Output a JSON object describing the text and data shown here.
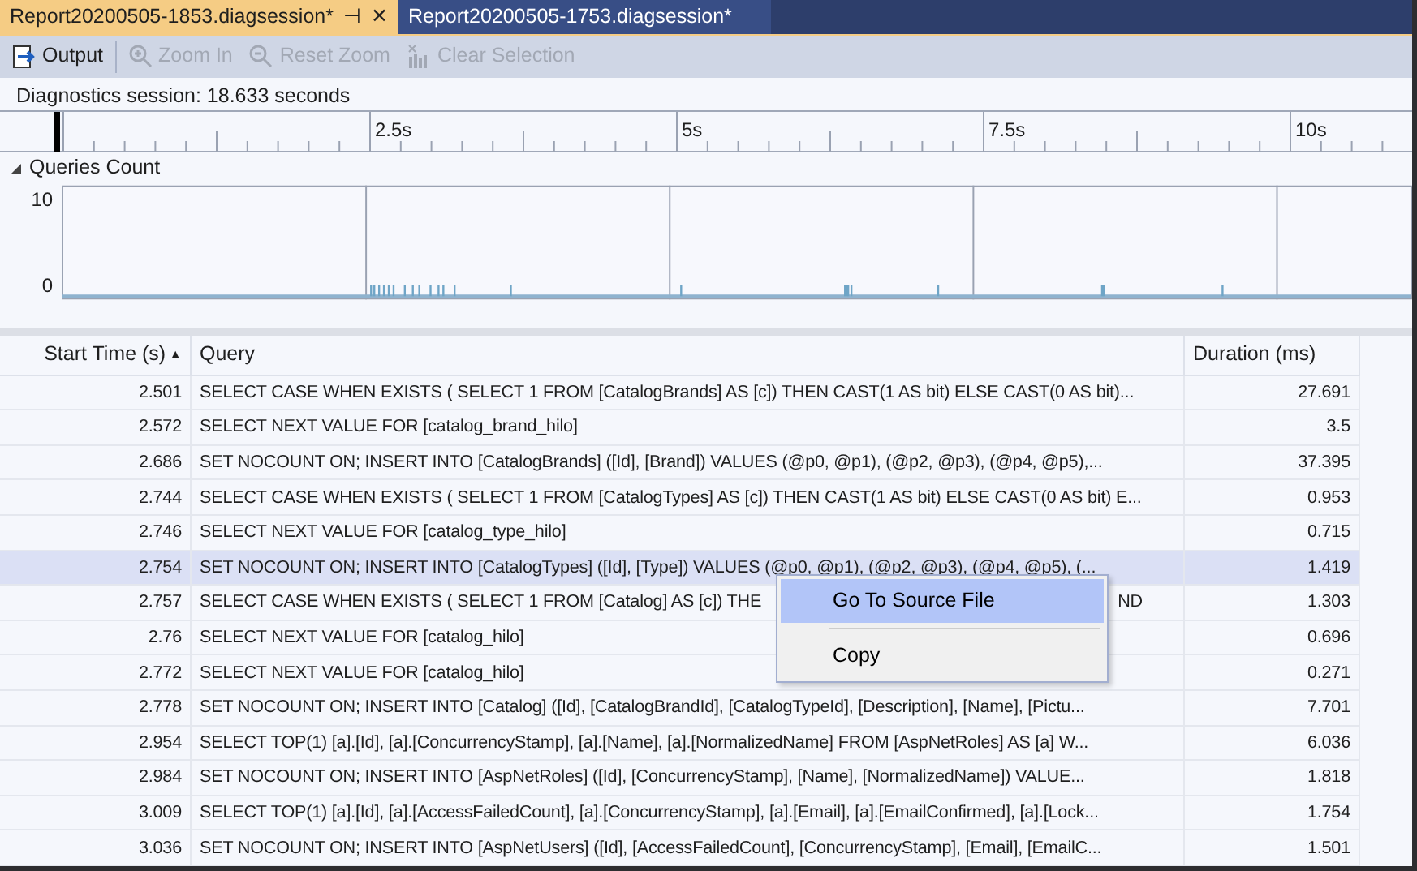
{
  "tabs": [
    {
      "label": "Report20200505-1853.diagsession*",
      "selected": true,
      "pin": "⊣",
      "close": "✕"
    },
    {
      "label": "Report20200505-1753.diagsession*",
      "selected": false
    }
  ],
  "toolbar": [
    {
      "label": "Output",
      "disabled": false
    },
    {
      "label": "Zoom In",
      "disabled": true
    },
    {
      "label": "Reset Zoom",
      "disabled": true
    },
    {
      "label": "Clear Selection",
      "disabled": true
    }
  ],
  "session": "Diagnostics session: 18.633 seconds",
  "ruler": {
    "labels": [
      "2.5s",
      "5s",
      "7.5s",
      "10s"
    ]
  },
  "track": {
    "title": "Queries Count",
    "expanded": true,
    "y_max": "10",
    "y_min": "0"
  },
  "table": {
    "columns": [
      {
        "label": "Start Time (s)",
        "sorted": true,
        "sort_glyph": "▲"
      },
      {
        "label": "Query"
      },
      {
        "label": "Duration (ms)"
      }
    ],
    "rows": [
      {
        "start": "2.501",
        "query": "SELECT CASE WHEN EXISTS ( SELECT 1 FROM [CatalogBrands] AS [c]) THEN CAST(1 AS bit) ELSE CAST(0 AS bit)...",
        "duration": "27.691",
        "selected": false
      },
      {
        "start": "2.572",
        "query": "SELECT NEXT VALUE FOR [catalog_brand_hilo]",
        "duration": "3.5",
        "selected": false
      },
      {
        "start": "2.686",
        "query": "SET NOCOUNT ON; INSERT INTO [CatalogBrands] ([Id], [Brand]) VALUES (@p0, @p1), (@p2, @p3), (@p4, @p5),...",
        "duration": "37.395",
        "selected": false
      },
      {
        "start": "2.744",
        "query": "SELECT CASE WHEN EXISTS ( SELECT 1 FROM [CatalogTypes] AS [c]) THEN CAST(1 AS bit) ELSE CAST(0 AS bit) E...",
        "duration": "0.953",
        "selected": false
      },
      {
        "start": "2.746",
        "query": "SELECT NEXT VALUE FOR [catalog_type_hilo]",
        "duration": "0.715",
        "selected": false
      },
      {
        "start": "2.754",
        "query": "SET NOCOUNT ON; INSERT INTO [CatalogTypes] ([Id], [Type]) VALUES (@p0, @p1), (@p2, @p3), (@p4, @p5), (...",
        "duration": "1.419",
        "selected": true
      },
      {
        "start": "2.757",
        "query": "SELECT CASE WHEN EXISTS ( SELECT 1 FROM [Catalog] AS [c]) THE",
        "query_tail": "ND",
        "duration": "1.303",
        "selected": false
      },
      {
        "start": "2.76",
        "query": "SELECT NEXT VALUE FOR [catalog_hilo]",
        "duration": "0.696",
        "selected": false
      },
      {
        "start": "2.772",
        "query": "SELECT NEXT VALUE FOR [catalog_hilo]",
        "duration": "0.271",
        "selected": false
      },
      {
        "start": "2.778",
        "query": "SET NOCOUNT ON; INSERT INTO [Catalog] ([Id], [CatalogBrandId], [CatalogTypeId], [Description], [Name], [Pictu...",
        "duration": "7.701",
        "selected": false
      },
      {
        "start": "2.954",
        "query": "SELECT TOP(1) [a].[Id], [a].[ConcurrencyStamp], [a].[Name], [a].[NormalizedName] FROM [AspNetRoles] AS [a] W...",
        "duration": "6.036",
        "selected": false
      },
      {
        "start": "2.984",
        "query": "SET NOCOUNT ON; INSERT INTO [AspNetRoles] ([Id], [ConcurrencyStamp], [Name], [NormalizedName]) VALUE...",
        "duration": "1.818",
        "selected": false
      },
      {
        "start": "3.009",
        "query": "SELECT TOP(1) [a].[Id], [a].[AccessFailedCount], [a].[ConcurrencyStamp], [a].[Email], [a].[EmailConfirmed], [a].[Lock...",
        "duration": "1.754",
        "selected": false
      },
      {
        "start": "3.036",
        "query": "SET NOCOUNT ON; INSERT INTO [AspNetUsers] ([Id], [AccessFailedCount], [ConcurrencyStamp], [Email], [EmailC...",
        "duration": "1.501",
        "selected": false
      }
    ]
  },
  "context_menu": [
    {
      "label": "Go To Source File",
      "selected": true
    },
    {
      "label": "Copy",
      "selected": false
    }
  ]
}
